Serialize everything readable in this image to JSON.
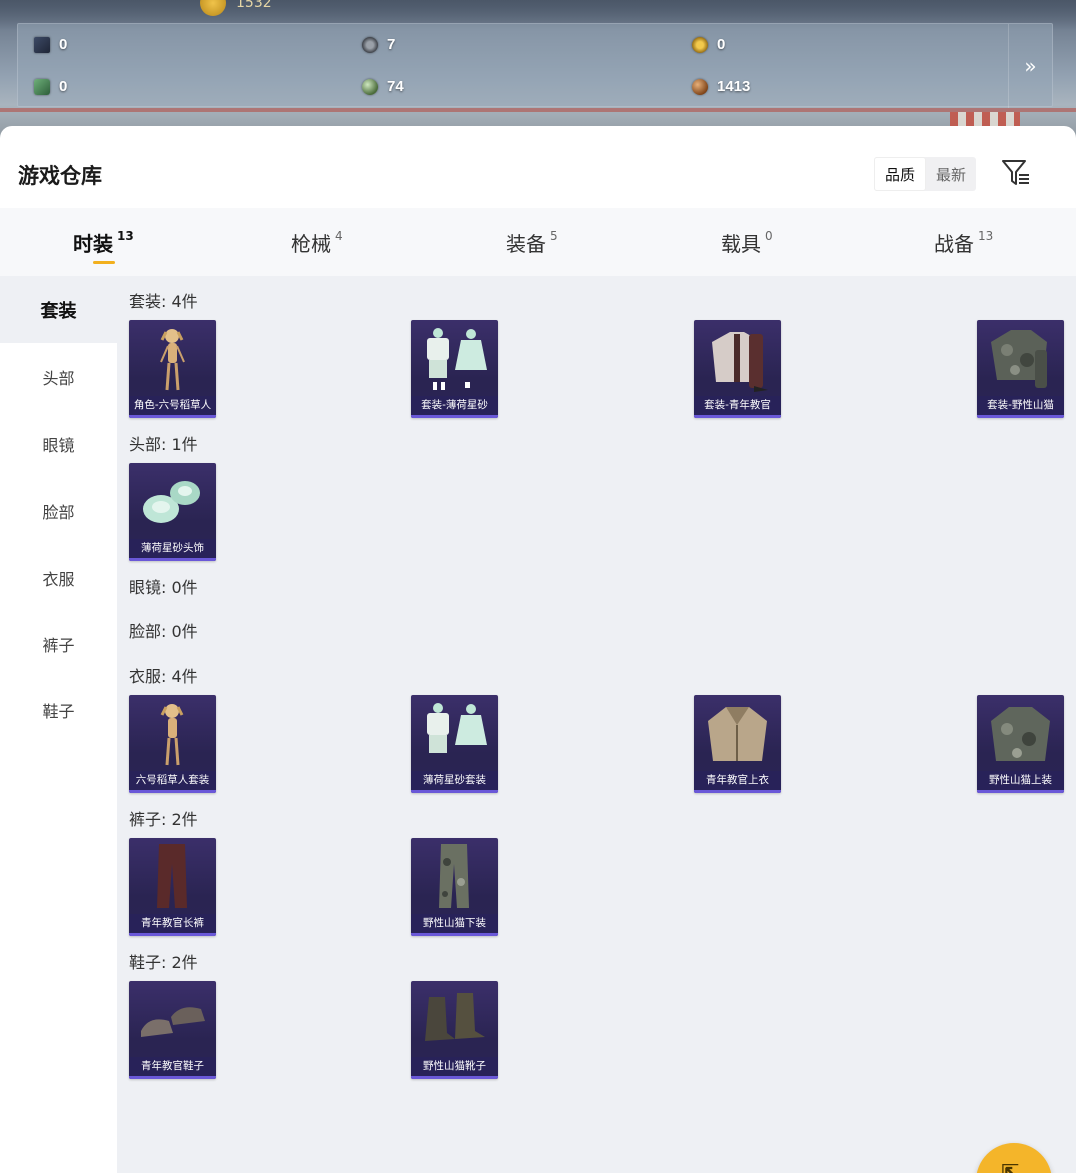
{
  "banner": {
    "top_value": "1532",
    "stats": [
      {
        "icon": "book-icon",
        "value": "0"
      },
      {
        "icon": "gear-icon",
        "value": "7"
      },
      {
        "icon": "gold-medal-icon",
        "value": "0"
      },
      {
        "icon": "green-gem-icon",
        "value": "0"
      },
      {
        "icon": "orb-icon",
        "value": "74"
      },
      {
        "icon": "bronze-coin-icon",
        "value": "1413"
      }
    ],
    "expand_label": "»"
  },
  "header": {
    "title": "游戏仓库",
    "sort_options": [
      "品质",
      "最新"
    ],
    "sort_active": "品质"
  },
  "tabs": [
    {
      "label": "时装",
      "count": "13",
      "active": true
    },
    {
      "label": "枪械",
      "count": "4",
      "active": false
    },
    {
      "label": "装备",
      "count": "5",
      "active": false
    },
    {
      "label": "载具",
      "count": "0",
      "active": false
    },
    {
      "label": "战备",
      "count": "13",
      "active": false
    }
  ],
  "sidenav": [
    "套装",
    "头部",
    "眼镜",
    "脸部",
    "衣服",
    "裤子",
    "鞋子"
  ],
  "sections": [
    {
      "label": "套装: 4件",
      "items": [
        "角色-六号稻草人",
        "套装-薄荷星砂",
        "套装-青年教官",
        "套装-野性山猫"
      ]
    },
    {
      "label": "头部: 1件",
      "items": [
        "薄荷星砂头饰"
      ]
    },
    {
      "label": "眼镜: 0件",
      "items": []
    },
    {
      "label": "脸部: 0件",
      "items": []
    },
    {
      "label": "衣服: 4件",
      "items": [
        "六号稻草人套装",
        "薄荷星砂套装",
        "青年教官上衣",
        "野性山猫上装"
      ]
    },
    {
      "label": "裤子: 2件",
      "items": [
        "青年教官长裤",
        "野性山猫下装"
      ]
    },
    {
      "label": "鞋子: 2件",
      "items": [
        "青年教官鞋子",
        "野性山猫靴子"
      ]
    }
  ],
  "colors": {
    "accent": "#f2b01e",
    "card_bg": "#2a2452",
    "panel_bg": "#eef0f4"
  }
}
